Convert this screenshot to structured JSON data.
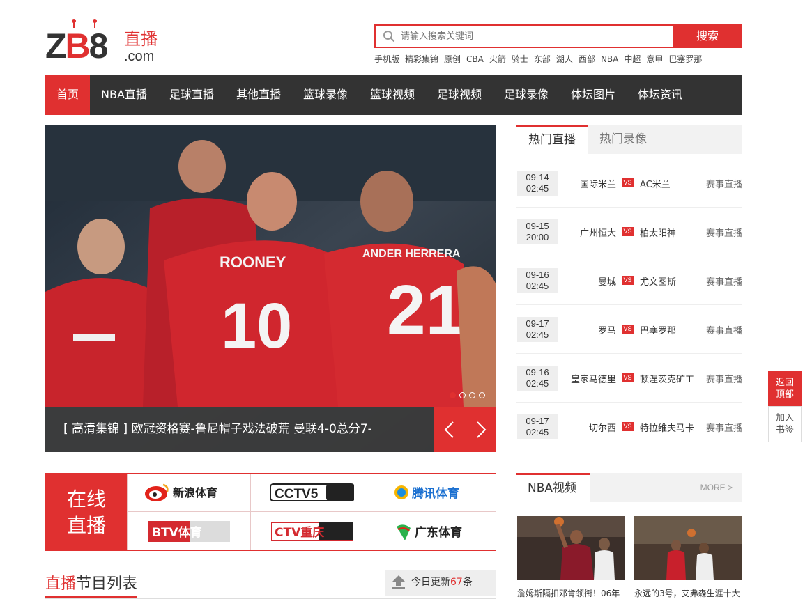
{
  "logo": {
    "mark": "ZB8",
    "cn": "直播",
    "domain": ".com"
  },
  "search": {
    "placeholder": "请输入搜索关键词",
    "button": "搜索"
  },
  "hotwords": [
    "手机版",
    "精彩集锦",
    "原创",
    "CBA",
    "火箭",
    "骑士",
    "东部",
    "湖人",
    "西部",
    "NBA",
    "中超",
    "意甲",
    "巴塞罗那"
  ],
  "nav": [
    "首页",
    "NBA直播",
    "足球直播",
    "其他直播",
    "篮球录像",
    "篮球视频",
    "足球视频",
    "足球录像",
    "体坛图片",
    "体坛资讯"
  ],
  "slider": {
    "caption": "[ 高清集锦 ] 欧冠资格赛-鲁尼帽子戏法破荒 曼联4-0总分7-",
    "dots": 4,
    "active_dot": 0
  },
  "channels": {
    "label_line1": "在线",
    "label_line2": "直播",
    "items": [
      {
        "name": "新浪体育"
      },
      {
        "name": "CCTV5"
      },
      {
        "name": "腾讯体育"
      },
      {
        "name": "BTV体育"
      },
      {
        "name": "CTV重庆"
      },
      {
        "name": "广东体育"
      }
    ]
  },
  "schedule": {
    "title_red": "直播",
    "title_rest": "节目列表",
    "update_prefix": "今日更新",
    "update_count": "67",
    "update_suffix": "条"
  },
  "tabs": [
    "热门直播",
    "热门录像"
  ],
  "matches": [
    {
      "date": "09-14",
      "time": "02:45",
      "home": "国际米兰",
      "away": "AC米兰",
      "link": "赛事直播"
    },
    {
      "date": "09-15",
      "time": "20:00",
      "home": "广州恒大",
      "away": "柏太阳神",
      "link": "赛事直播"
    },
    {
      "date": "09-16",
      "time": "02:45",
      "home": "曼城",
      "away": "尤文图斯",
      "link": "赛事直播"
    },
    {
      "date": "09-17",
      "time": "02:45",
      "home": "罗马",
      "away": "巴塞罗那",
      "link": "赛事直播"
    },
    {
      "date": "09-16",
      "time": "02:45",
      "home": "皇家马德里",
      "away": "顿涅茨克矿工",
      "link": "赛事直播"
    },
    {
      "date": "09-17",
      "time": "02:45",
      "home": "切尔西",
      "away": "特拉维夫马卡",
      "link": "赛事直播"
    }
  ],
  "vs_label": "VS",
  "nba": {
    "title": "NBA视频",
    "more": "MORE >",
    "videos": [
      {
        "caption": "詹姆斯隔扣邓肯领衔！06年"
      },
      {
        "caption": "永远的3号，艾弗森生涯十大"
      }
    ]
  },
  "float": {
    "top1": "返回",
    "top2": "顶部",
    "bm1": "加入",
    "bm2": "书签"
  },
  "colors": {
    "accent": "#e03030",
    "nav_bg": "#333333"
  }
}
